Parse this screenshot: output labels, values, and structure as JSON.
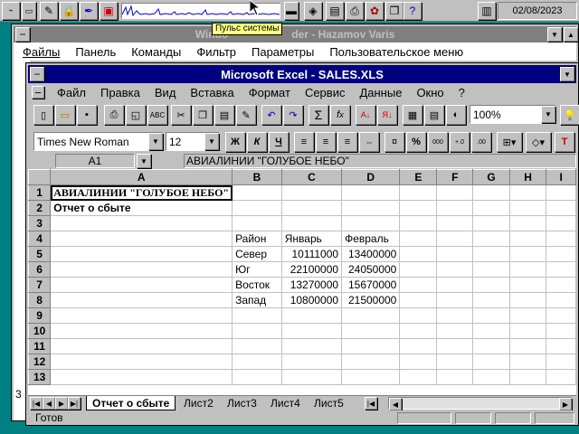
{
  "taskbar": {
    "tooltip": "Пульс системы",
    "date": "02/08/2023",
    "icons": [
      "network-icon",
      "drive-icon",
      "lock-icon",
      "brush-icon",
      "monitor-icon",
      "pulse-graph",
      "keyboard-icon",
      "disk-icon",
      "folder-icon",
      "printer-icon",
      "gear-icon",
      "help-icon",
      "book-icon"
    ]
  },
  "wc": {
    "title_left": "Windo",
    "title_right": "der - Hazamov Varis",
    "menu": [
      "Файлы",
      "Панель",
      "Команды",
      "Фильтр",
      "Параметры",
      "Пользовательское меню"
    ],
    "side_text": "3"
  },
  "excel": {
    "title": "Microsoft Excel - SALES.XLS",
    "menu": [
      "Файл",
      "Правка",
      "Вид",
      "Вставка",
      "Формат",
      "Сервис",
      "Данные",
      "Окно",
      "?"
    ],
    "zoom": "100%",
    "font_name": "Times New Roman",
    "font_size": "12",
    "bold_btn": "Ж",
    "italic_btn": "К",
    "underline_btn": "Ч",
    "cell_ref": "A1",
    "formula": "АВИАЛИНИИ \"ГОЛУБОЕ НЕБО\"",
    "columns": [
      "A",
      "B",
      "C",
      "D",
      "E",
      "F",
      "G",
      "H",
      "I"
    ],
    "rows": [
      {
        "n": "1",
        "a": "АВИАЛИНИИ \"ГОЛУБОЕ НЕБО\"",
        "b": "",
        "c": "",
        "d": ""
      },
      {
        "n": "2",
        "a": "Отчет о сбыте",
        "b": "",
        "c": "",
        "d": ""
      },
      {
        "n": "3",
        "a": "",
        "b": "",
        "c": "",
        "d": ""
      },
      {
        "n": "4",
        "a": "",
        "b": "Район",
        "c": "Январь",
        "d": "Февраль"
      },
      {
        "n": "5",
        "a": "",
        "b": "Север",
        "c": "10111000",
        "d": "13400000"
      },
      {
        "n": "6",
        "a": "",
        "b": "Юг",
        "c": "22100000",
        "d": "24050000"
      },
      {
        "n": "7",
        "a": "",
        "b": "Восток",
        "c": "13270000",
        "d": "15670000"
      },
      {
        "n": "8",
        "a": "",
        "b": "Запад",
        "c": "10800000",
        "d": "21500000"
      },
      {
        "n": "9",
        "a": "",
        "b": "",
        "c": "",
        "d": ""
      },
      {
        "n": "10",
        "a": "",
        "b": "",
        "c": "",
        "d": ""
      },
      {
        "n": "11",
        "a": "",
        "b": "",
        "c": "",
        "d": ""
      },
      {
        "n": "12",
        "a": "",
        "b": "",
        "c": "",
        "d": ""
      },
      {
        "n": "13",
        "a": "",
        "b": "",
        "c": "",
        "d": ""
      }
    ],
    "sheets": [
      "Отчет о сбыте",
      "Лист2",
      "Лист3",
      "Лист4",
      "Лист5"
    ],
    "status": "Готов"
  }
}
